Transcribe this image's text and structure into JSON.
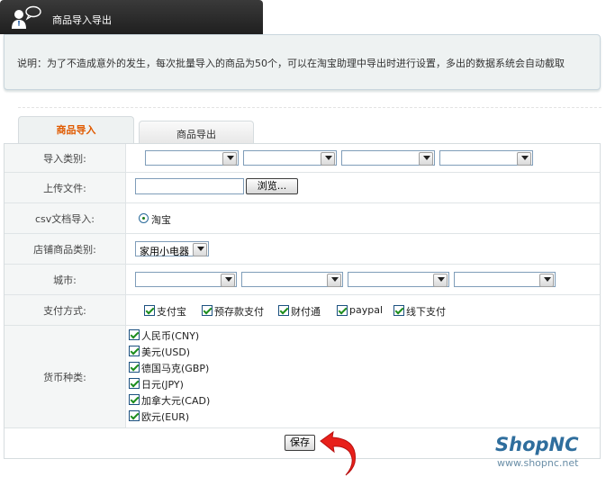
{
  "header": {
    "title": "商品导入导出"
  },
  "notice": {
    "text": "说明：为了不造成意外的发生，每次批量导入的商品为50个，可以在淘宝助理中导出时进行设置，多出的数据系统会自动截取"
  },
  "tabs": [
    {
      "label": "商品导入",
      "active": true
    },
    {
      "label": "商品导出",
      "active": false
    }
  ],
  "form": {
    "import_category_label": "导入类别:",
    "upload_label": "上传文件:",
    "browse_label": "浏览...",
    "csv_label": "csv文档导入:",
    "csv_option": "淘宝",
    "store_category_label": "店铺商品类别:",
    "store_category_value": "家用小电器",
    "city_label": "城市:",
    "payment_label": "支付方式:",
    "payments": [
      "支付宝",
      "预存款支付",
      "财付通",
      "paypal",
      "线下支付"
    ],
    "currency_label": "货币种类:",
    "currencies": [
      "人民币(CNY)",
      "美元(USD)",
      "德国马克(GBP)",
      "日元(JPY)",
      "加拿大元(CAD)",
      "欧元(EUR)"
    ],
    "save_label": "保存"
  },
  "watermark": {
    "brand": "ShopNC",
    "url": "www.shopnc.net"
  },
  "colors": {
    "header_bg": "#2a2a2a",
    "active_tab": "#e05a00",
    "brand": "#2f6e9d",
    "arrow": "#e8201a"
  }
}
